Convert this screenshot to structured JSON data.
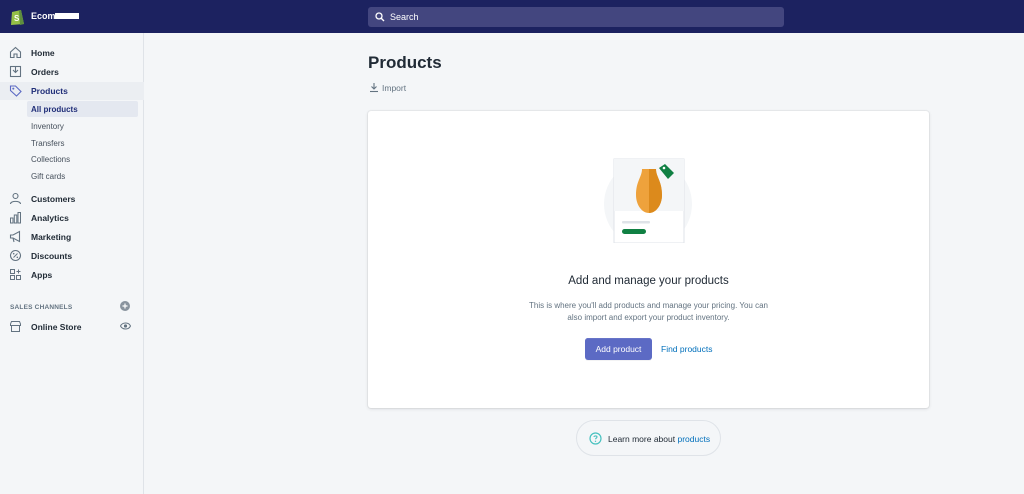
{
  "topbar": {
    "store_name": "Ecom",
    "search_placeholder": "Search"
  },
  "sidebar": {
    "items": [
      {
        "label": "Home",
        "icon": "home-icon"
      },
      {
        "label": "Orders",
        "icon": "orders-icon"
      },
      {
        "label": "Products",
        "icon": "tag-icon"
      },
      {
        "label": "Customers",
        "icon": "person-icon"
      },
      {
        "label": "Analytics",
        "icon": "bar-chart-icon"
      },
      {
        "label": "Marketing",
        "icon": "megaphone-icon"
      },
      {
        "label": "Discounts",
        "icon": "discount-icon"
      },
      {
        "label": "Apps",
        "icon": "apps-icon"
      }
    ],
    "product_subitems": [
      {
        "label": "All products"
      },
      {
        "label": "Inventory"
      },
      {
        "label": "Transfers"
      },
      {
        "label": "Collections"
      },
      {
        "label": "Gift cards"
      }
    ],
    "sales_channels_title": "SALES CHANNELS",
    "online_store_label": "Online Store"
  },
  "main": {
    "title": "Products",
    "import_label": "Import",
    "empty_state": {
      "heading": "Add and manage your products",
      "description": "This is where you'll add products and manage your pricing. You can also import and export your product inventory.",
      "primary_button": "Add product",
      "secondary_link": "Find products"
    },
    "learn_more": {
      "prefix": "Learn more about ",
      "link": "products"
    }
  },
  "colors": {
    "topbar": "#1c2260",
    "search_bg": "#43467f",
    "primary": "#5c6ac4",
    "link": "#006fbb",
    "accent_green": "#108043",
    "accent_orange": "#eea23c"
  }
}
